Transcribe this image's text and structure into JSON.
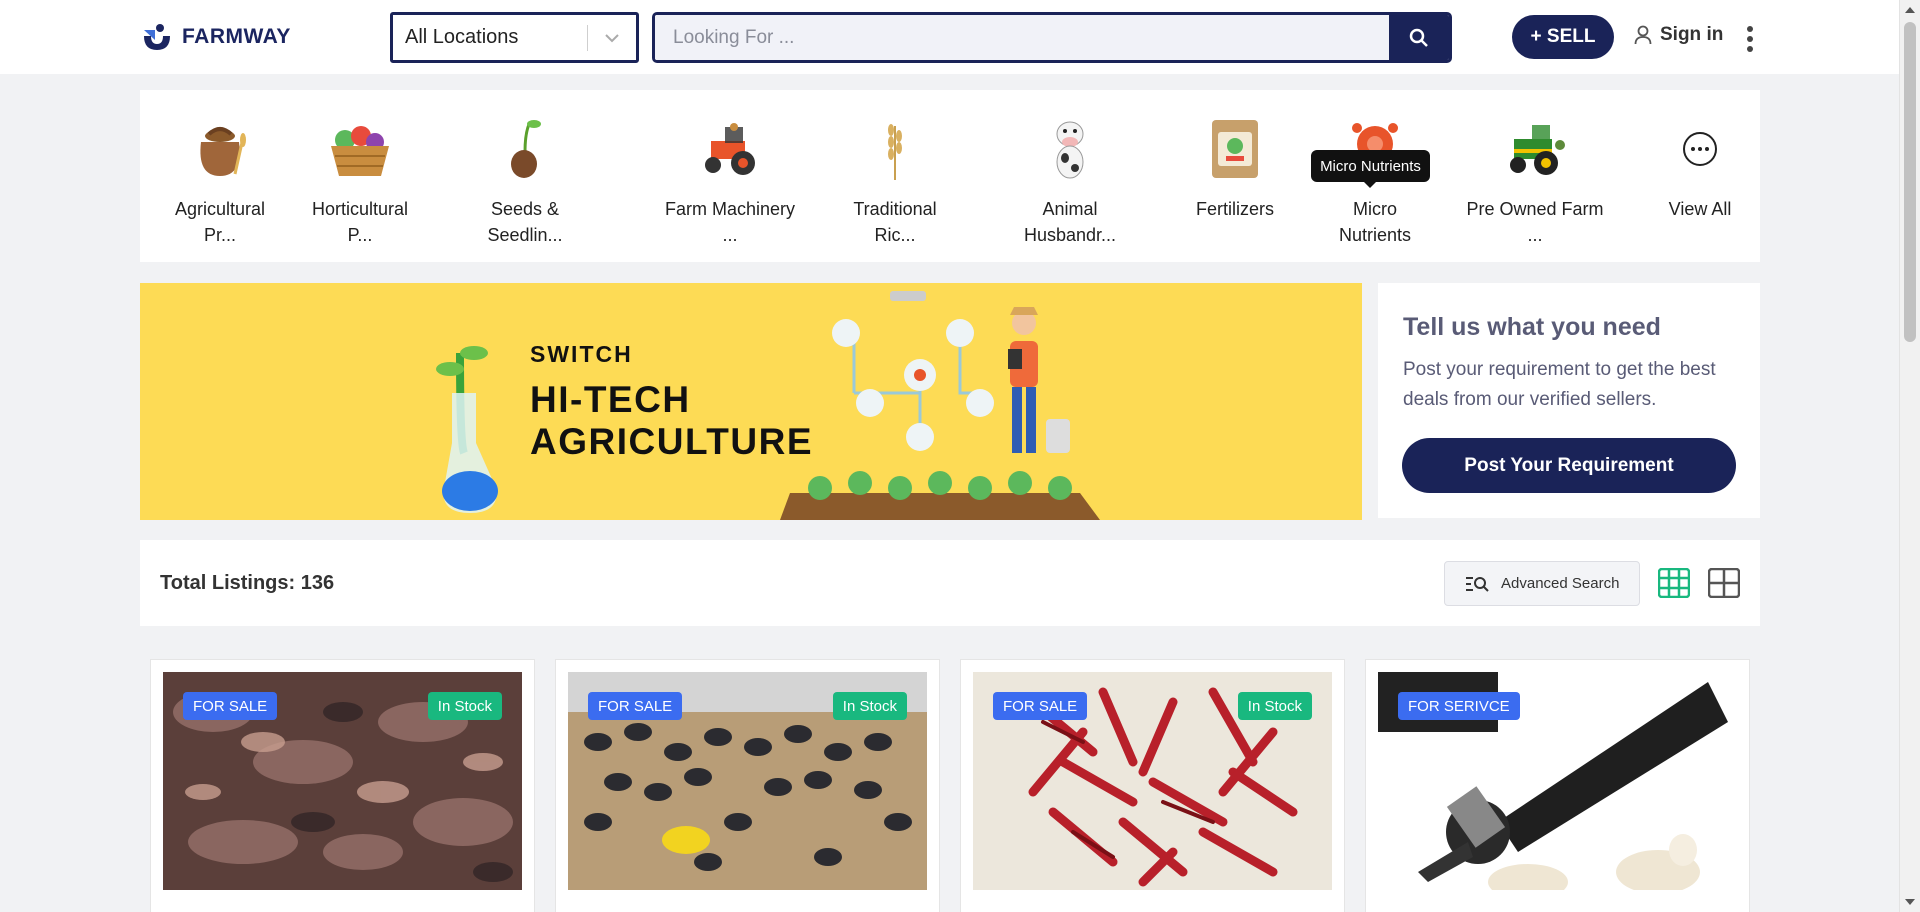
{
  "brand": {
    "name": "FARMWAY"
  },
  "header": {
    "location": "All Locations",
    "search_placeholder": "Looking For ...",
    "sell_label": "+ SELL",
    "signin_label": "Sign in"
  },
  "categories": [
    {
      "label": "Agricultural Pr...",
      "icon": "grain-sack-icon"
    },
    {
      "label": "Horticultural P...",
      "icon": "vegetable-basket-icon"
    },
    {
      "label": "Seeds & Seedlin...",
      "icon": "sprouting-seed-icon"
    },
    {
      "label": "Farm Machinery ...",
      "icon": "tractor-icon"
    },
    {
      "label": "Traditional Ric...",
      "icon": "rice-stalk-icon"
    },
    {
      "label": "Animal Husbandr...",
      "icon": "cow-icon"
    },
    {
      "label": "Fertilizers",
      "icon": "fertilizer-bag-icon"
    },
    {
      "label": "Micro Nutrients",
      "icon": "nutrient-molecule-icon"
    },
    {
      "label": "Pre Owned Farm ...",
      "icon": "green-tractor-icon"
    },
    {
      "label": "View All",
      "icon": "more-horizontal-icon"
    }
  ],
  "tooltip": "Micro Nutrients",
  "banner": {
    "line1": "SWITCH",
    "line2": "HI-TECH",
    "line3": "AGRICULTURE"
  },
  "requirement": {
    "title": "Tell us what you need",
    "description": "Post your requirement to get the best deals from our verified sellers.",
    "button": "Post Your Requirement"
  },
  "listing": {
    "total": "Total Listings: 136",
    "advanced_search": "Advanced Search"
  },
  "products": [
    {
      "type": "FOR SALE",
      "stock": "In Stock",
      "image": "dried-leaves-photo"
    },
    {
      "type": "FOR SALE",
      "stock": "In Stock",
      "image": "poultry-chicks-photo"
    },
    {
      "type": "FOR SALE",
      "stock": "In Stock",
      "image": "red-chillies-photo"
    },
    {
      "type": "FOR SERIVCE",
      "stock": "",
      "image": "sheep-shearing-clipper-photo"
    }
  ],
  "colors": {
    "primary": "#1a2358",
    "accent_green": "#19b87f",
    "badge_blue": "#3b6cf0",
    "banner_yellow": "#fddb55"
  }
}
